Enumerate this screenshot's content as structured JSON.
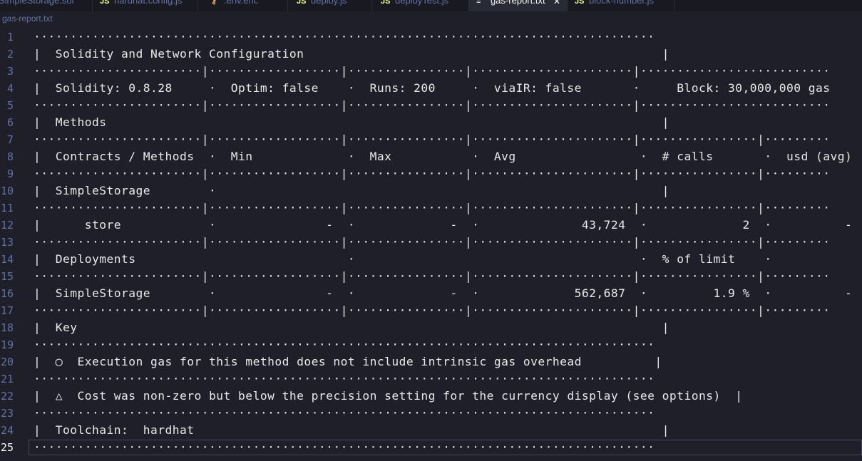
{
  "tabs": [
    {
      "label": "SimpleStorage.sol",
      "icon": "",
      "active": false
    },
    {
      "label": "hardhat.config.js",
      "icon": "JS",
      "active": false
    },
    {
      "label": ".env.enc",
      "icon": "",
      "active": false
    },
    {
      "label": "deploy.js",
      "icon": "JS",
      "active": false
    },
    {
      "label": "deployTest.js",
      "icon": "JS",
      "active": false
    },
    {
      "label": "gas-report.txt",
      "icon": "",
      "active": true,
      "close": "✕"
    },
    {
      "label": "block-number.js",
      "icon": "JS",
      "active": false
    }
  ],
  "breadcrumb": "gas-report.txt",
  "current_line": 25,
  "lines": [
    {
      "n": "1",
      "text": "·····················································································"
    },
    {
      "n": "2",
      "text": "|  Solidity and Network Configuration                                                 |"
    },
    {
      "n": "3",
      "text": "·······················|··················|················|······················|··························"
    },
    {
      "n": "4",
      "text": "|  Solidity: 0.8.28     ·  Optim: false    ·  Runs: 200     ·  viaIR: false       ·     Block: 30,000,000 gas    |"
    },
    {
      "n": "5",
      "text": "·······················|··················|················|······················|··························"
    },
    {
      "n": "6",
      "text": "|  Methods                                                                            |"
    },
    {
      "n": "7",
      "text": "·······················|··················|················|······················|················|·········"
    },
    {
      "n": "8",
      "text": "|  Contracts / Methods  ·  Min             ·  Max           ·  Avg                 ·  # calls       ·  usd (avg)  |"
    },
    {
      "n": "9",
      "text": "·······················|··················|················|······················|················|·········"
    },
    {
      "n": "10",
      "text": "|  SimpleStorage        ·                                                             |"
    },
    {
      "n": "11",
      "text": "·······················|··················|················|······················|················|·········"
    },
    {
      "n": "12",
      "text": "|      store            ·               -  ·             -  ·              43,724  ·             2  ·          -  |"
    },
    {
      "n": "13",
      "text": "·······················|··················|················|······················|················|·········"
    },
    {
      "n": "14",
      "text": "|  Deployments                             ·                                       ·  % of limit    ·             |"
    },
    {
      "n": "15",
      "text": "·······················|··················|················|······················|················|·········"
    },
    {
      "n": "16",
      "text": "|  SimpleStorage        ·               -  ·             -  ·             562,687  ·         1.9 %  ·          -  |"
    },
    {
      "n": "17",
      "text": "·······················|··················|················|······················|················|·········"
    },
    {
      "n": "18",
      "text": "|  Key                                                                                |"
    },
    {
      "n": "19",
      "text": "·····················································································"
    },
    {
      "n": "20",
      "text": "|  ◯  Execution gas for this method does not include intrinsic gas overhead          |"
    },
    {
      "n": "21",
      "text": "·····················································································"
    },
    {
      "n": "22",
      "text": "|  △  Cost was non-zero but below the precision setting for the currency display (see options)  |"
    },
    {
      "n": "23",
      "text": "·····················································································"
    },
    {
      "n": "24",
      "text": "|  Toolchain:  hardhat                                                                |"
    },
    {
      "n": "25",
      "text": "·····················································································"
    }
  ],
  "colors": {
    "background": "#1e1f29",
    "tabbar": "#191a21",
    "text": "#e8e8e8",
    "line_number": "#6272a4",
    "js_icon": "#f1fa8c"
  }
}
